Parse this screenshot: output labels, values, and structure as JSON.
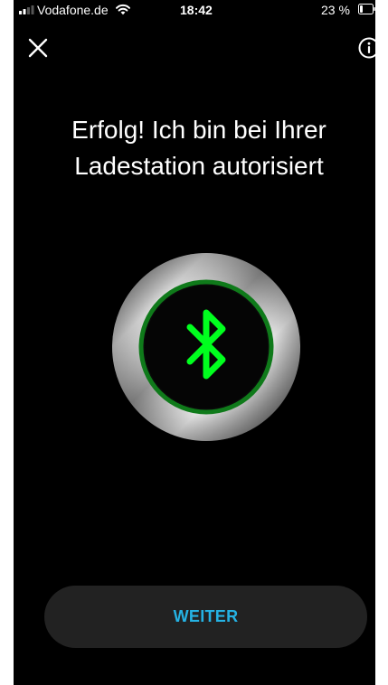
{
  "status_bar": {
    "carrier": "Vodafone.de",
    "time": "18:42",
    "battery_percent": "23 %",
    "battery_level": 0.23,
    "signal_bars_filled": 2,
    "icons": [
      "signal-icon",
      "wifi-icon",
      "battery-icon"
    ]
  },
  "header": {
    "close_icon": "close-icon",
    "info_icon": "info-icon"
  },
  "main": {
    "title_line1": "Erfolg! Ich bin bei Ihrer",
    "title_line2": "Ladestation autorisiert",
    "illustration_icon": "bluetooth-icon",
    "ring_color": "#00ff1e",
    "bluetooth_color": "#00ff1e"
  },
  "footer": {
    "continue_label": "WEITER",
    "continue_color": "#25b2e3",
    "button_bg": "#222222"
  }
}
